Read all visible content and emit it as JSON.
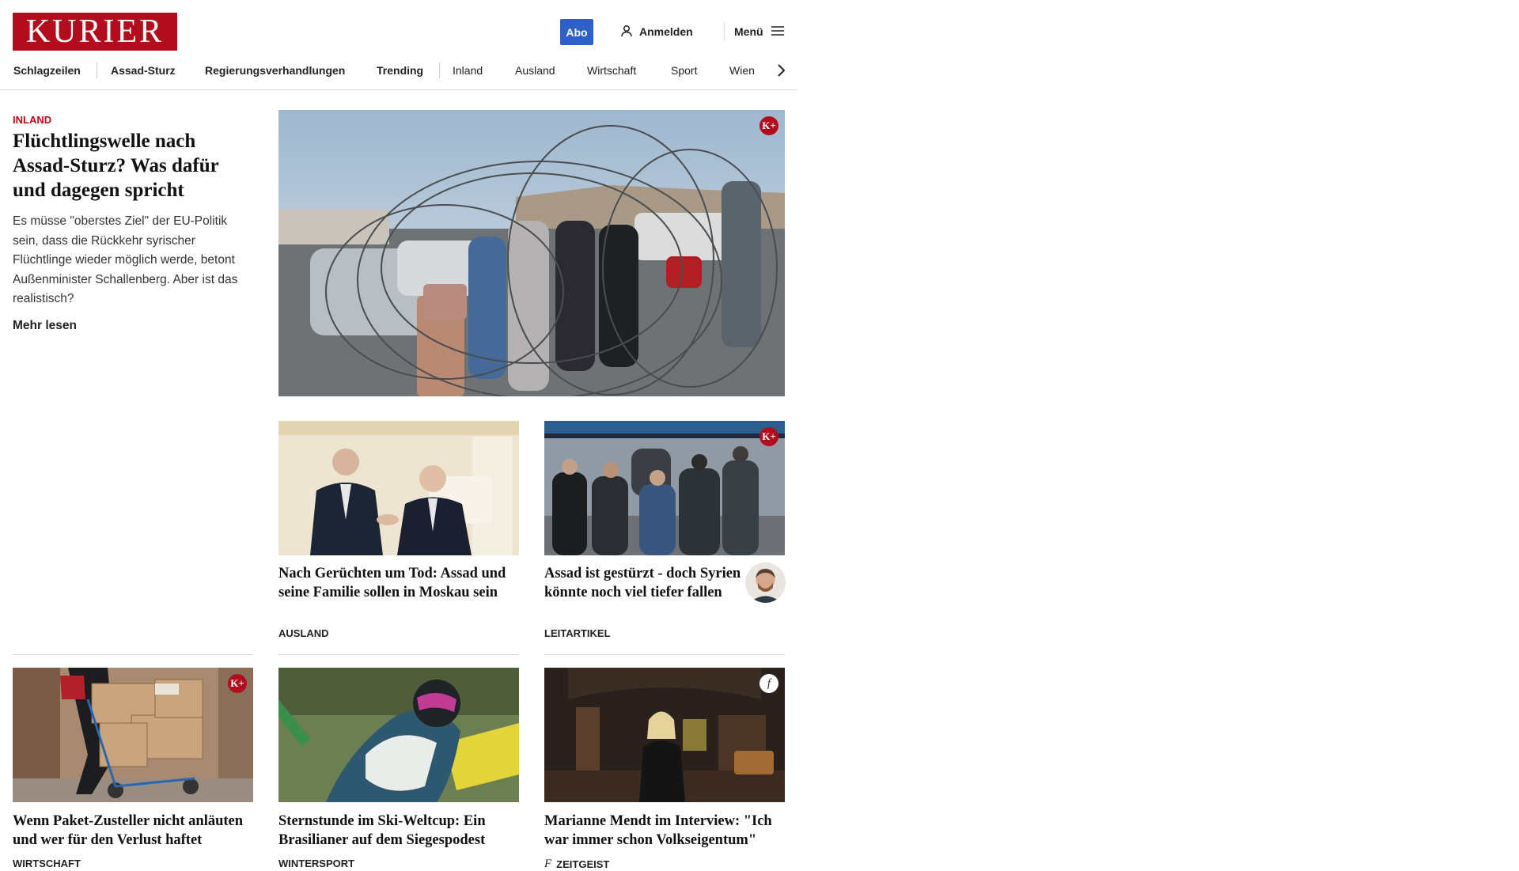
{
  "header": {
    "logo_text": "KURIER",
    "abo_label": "Abo",
    "login_label": "Anmelden",
    "menu_label": "Menü",
    "brand_color": "#b30c1d",
    "abo_color": "#2d60c8"
  },
  "nav": {
    "items": [
      "Schlagzeilen",
      "Assad-Sturz",
      "Regierungsverhandlungen",
      "Trending",
      "Inland",
      "Ausland",
      "Wirtschaft",
      "Sport",
      "Wien"
    ]
  },
  "lead": {
    "category": "INLAND",
    "title": "Flüchtlingswelle nach Assad-Sturz? Was dafür und dagegen spricht",
    "teaser": "Es müsse \"oberstes Ziel\" der EU-Politik sein, dass die Rückkehr syrischer Flüchtlinge wieder möglich werde, betont Außenminister Schallenberg. Aber ist das realistisch?",
    "more_label": "Mehr lesen",
    "badge": "K+"
  },
  "cards": [
    {
      "title": "Nach Gerüchten um Tod: Assad und seine Familie sollen in Moskau sein",
      "category": "AUSLAND"
    },
    {
      "title": "Assad ist gestürzt - doch Syrien könnte noch viel tie­fer fallen",
      "category": "LEITARTIKEL",
      "badge": "K+"
    },
    {
      "title": "Wenn Paket-Zusteller nicht anläu­ten und wer für den Verlust haftet",
      "category": "WIRTSCHAFT",
      "badge": "K+"
    },
    {
      "title": "Sternstunde im Ski-Weltcup: Ein Brasilianer auf dem Siegespodest",
      "category": "WINTERSPORT"
    },
    {
      "title": "Marianne Mendt im Interview: \"Ich war immer schon Volkseigentum\"",
      "category": "ZEITGEIST",
      "badge": "f"
    }
  ],
  "icons": {
    "user": "user-icon",
    "menu": "hamburger-icon",
    "nav_next": "chevron-right-icon",
    "kplus": "kurier-plus-badge-icon",
    "zeitgeist": "zeitgeist-f-icon"
  }
}
